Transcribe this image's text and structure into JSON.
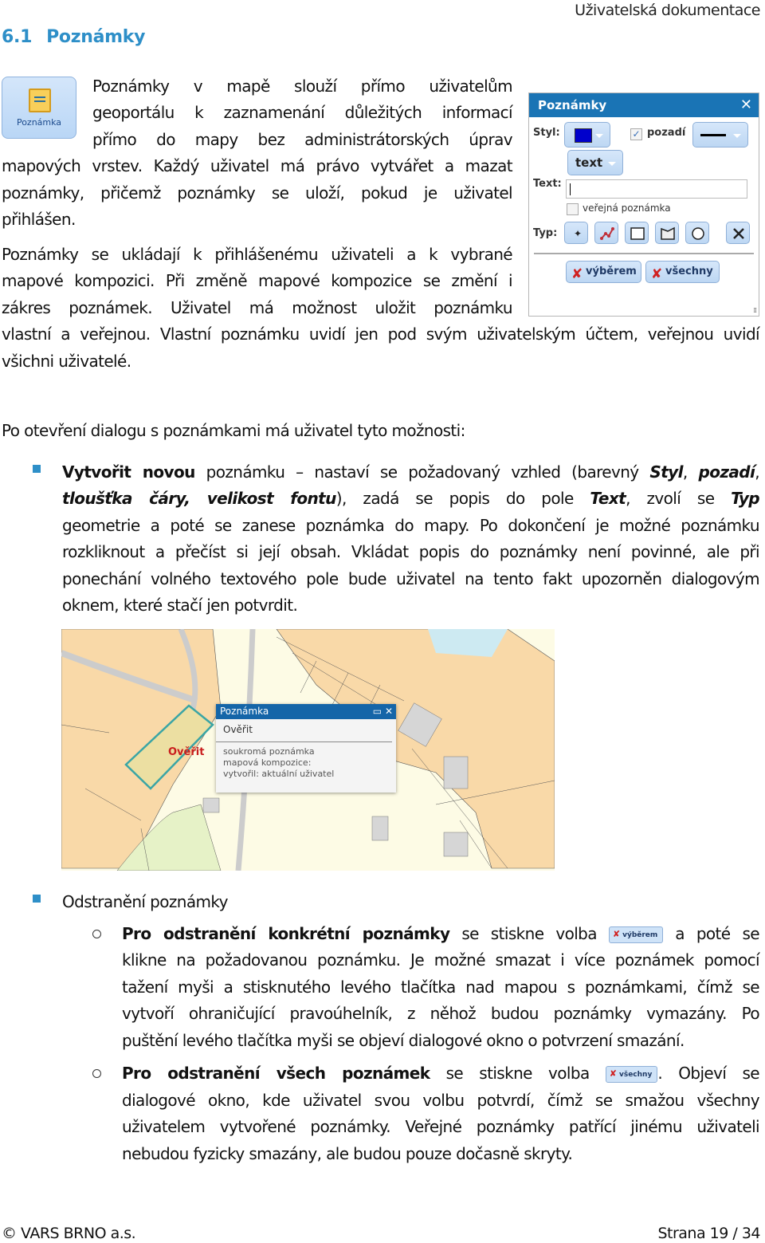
{
  "header": {
    "doc_title": "Uživatelská dokumentace"
  },
  "section": {
    "number": "6.1",
    "title": "Poznámky"
  },
  "toolbar_button": {
    "label": "Poznámka",
    "icon": "sticky-note-icon"
  },
  "intro": {
    "lines_beside_icon": [
      "Poznámky v mapě slouží přímo uživatelům",
      "geoportálu k zaznamenání důležitých informací",
      "přímo do mapy bez administrátorských úprav"
    ],
    "lines_after_icon": [
      "mapových vrstev. Každý uživatel má právo vytvářet a mazat",
      "poznámky, přičemž poznámky se uloží, pokud je uživatel"
    ],
    "last_line": "přihlášen."
  },
  "paragraph2": {
    "lines_beside_dialog": [
      "Poznámky se ukládají k přihlášenému uživateli a k vybrané",
      "mapové kompozici. Při změně mapové kompozice se změní i",
      "zákres poznámek. Uživatel má možnost uložit poznámku"
    ],
    "full_line": "vlastní a veřejnou. Vlastní poznámku uvidí jen pod svým uživatelským účtem, veřejnou uvidí",
    "last_line": "všichni uživatelé."
  },
  "dialog": {
    "title": "Poznámky",
    "style_label": "Styl:",
    "style_color": "#0000cc",
    "background_checkbox_label": "pozadí",
    "background_checked": true,
    "font_size_select": "text",
    "text_label": "Text:",
    "text_value": "",
    "public_checkbox_label": "veřejná poznámka",
    "public_checked": false,
    "type_label": "Typ:",
    "type_tools": [
      "point-icon",
      "line-icon",
      "rectangle-icon",
      "polygon-icon",
      "circle-icon"
    ],
    "cancel_tool": "close-icon",
    "delete_selected_label": "výběrem",
    "delete_all_label": "všechny"
  },
  "options_intro": "Po otevření dialogu s poznámkami má uživatel tyto možnosti:",
  "create_item": {
    "bold": "Vytvořit novou",
    "lines": [
      "poznámku – nastaví se požadovaný vzhled (barevný",
      "geometrie a poté se zanese poznámka do mapy. Po dokončení je možné poznámku",
      "rozkliknout a přečíst si její obsah. Vkládat popis do poznámky není povinné, ale při",
      "ponechání volného textového pole bude uživatel na tento fakt upozorněn dialogovým",
      "oknem, které stačí jen potvrdit."
    ],
    "styl": "Styl",
    "pozadi": "pozadí",
    "tloustka": "tloušťka čáry,",
    "velikost": "velikost fontu",
    "zada": "), zadá se popis do pole",
    "text": "Text",
    "zvoli": ", zvolí se",
    "typ": "Typ"
  },
  "map_screenshot": {
    "feature_label": "Ověřit",
    "popup": {
      "title": "Poznámka",
      "heading": "Ověřit",
      "lines": [
        "soukromá poznámka",
        "mapová kompozice:",
        "vytvořil: aktuální uživatel"
      ]
    }
  },
  "remove_item": {
    "title": "Odstranění poznámky",
    "sub1": {
      "bold": "Pro odstranění konkrétní poznámky",
      "pre": "se stiskne volba",
      "button": "výběrem",
      "post": "a poté se",
      "lines": [
        "klikne na požadovanou poznámku. Je možné smazat i více poznámek pomocí",
        "tažení myši a stisknutého levého tlačítka nad mapou s poznámkami, čímž se",
        "vytvoří ohraničující pravoúhelník, z něhož budou poznámky vymazány. Po",
        "puštění levého tlačítka myši se objeví dialogové okno o potvrzení smazání."
      ]
    },
    "sub2": {
      "bold": "Pro odstranění všech poznámek",
      "pre": "se stiskne volba",
      "button": "všechny",
      "post": ". Objeví se",
      "lines": [
        "dialogové okno, kde uživatel svou volbu potvrdí, čímž se smažou všechny",
        "uživatelem vytvořené poznámky. Veřejné poznámky patřící jinému uživateli",
        "nebudou fyzicky smazány, ale budou pouze dočasně skryty."
      ]
    }
  },
  "footer": {
    "company": "© VARS BRNO a.s.",
    "page": "Strana 19 / 34"
  },
  "colors": {
    "heading": "#2e8fc8",
    "dialog_title": "#1a74b5",
    "delete_x": "#d02020"
  }
}
